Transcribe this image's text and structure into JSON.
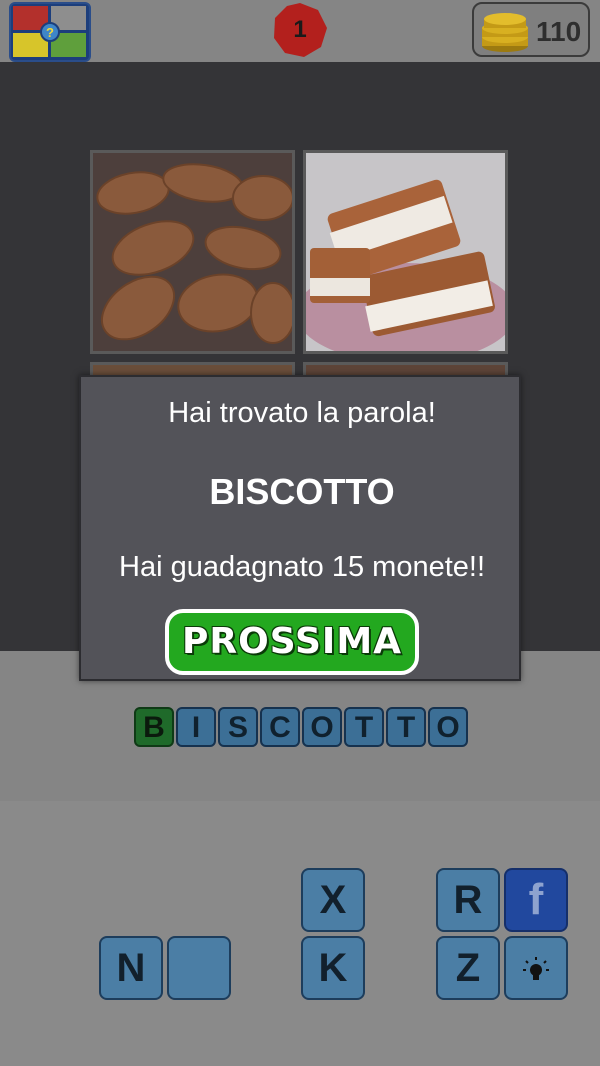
{
  "header": {
    "level": "1",
    "coins": "110"
  },
  "dialog": {
    "title": "Hai trovato la parola!",
    "word": "BISCOTTO",
    "reward": "Hai guadagnato 15 monete!!",
    "next_label": "PROSSIMA"
  },
  "answer": [
    "B",
    "I",
    "S",
    "C",
    "O",
    "T",
    "T",
    "O"
  ],
  "keyboard": {
    "row1": [
      "X",
      "R"
    ],
    "row2": [
      "N",
      "",
      "K",
      "Z"
    ],
    "facebook_label": "f"
  },
  "colors": {
    "tile_blue": "#3c6f96",
    "tile_green": "#1f6a2a",
    "button_green": "#23a81f",
    "badge_red": "#b3201d"
  },
  "icons": {
    "logo": "four-pics-logo-icon",
    "coins": "coin-stack-icon",
    "hint": "lightbulb-icon",
    "share": "facebook-icon"
  }
}
